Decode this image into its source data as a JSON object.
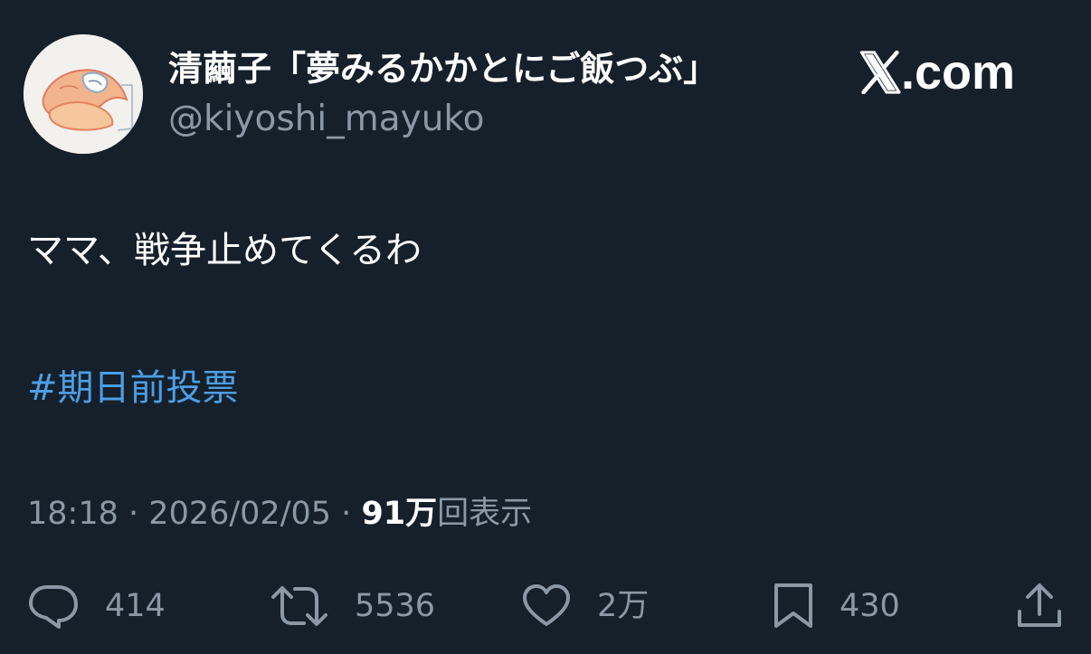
{
  "author": {
    "display_name": "清繭子「夢みるかかとにご飯つぶ」",
    "handle": "@kiyoshi_mayuko"
  },
  "brand": {
    "logo_icon": "x-logo-icon",
    "domain": ".com"
  },
  "tweet": {
    "text": "ママ、戦争止めてくるわ",
    "hashtag": "#期日前投票"
  },
  "meta": {
    "time": "18:18",
    "separator": "·",
    "date": "2026/02/05",
    "views_count": "91万",
    "views_label": "回表示"
  },
  "actions": {
    "reply": {
      "icon": "reply-icon",
      "count": "414"
    },
    "retweet": {
      "icon": "retweet-icon",
      "count": "5536"
    },
    "like": {
      "icon": "heart-icon",
      "count": "2万"
    },
    "bookmark": {
      "icon": "bookmark-icon",
      "count": "430"
    },
    "share": {
      "icon": "share-icon"
    }
  },
  "colors": {
    "background": "#15202b",
    "primary_text": "#ffffff",
    "secondary_text": "#8b98a5",
    "link": "#4c9fe6"
  }
}
